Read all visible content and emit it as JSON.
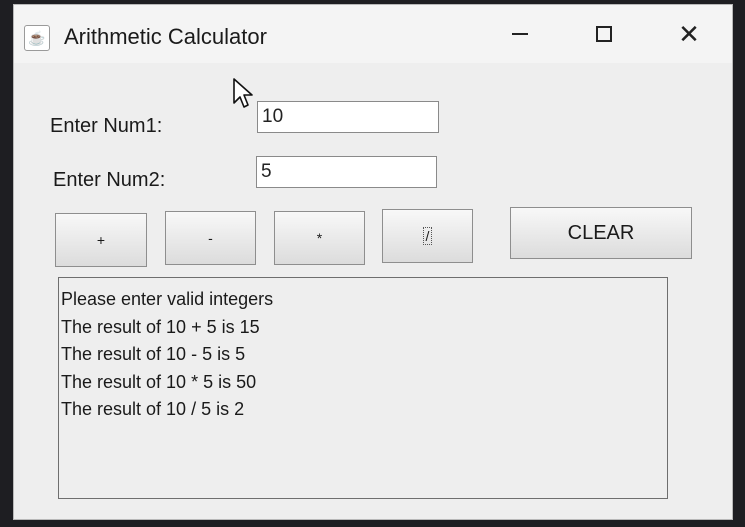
{
  "window": {
    "title": "Arithmetic Calculator",
    "icon": "java-cup-icon",
    "controls": {
      "minimize_icon": "minimize-icon",
      "maximize_icon": "maximize-icon",
      "close_label": "✕"
    }
  },
  "form": {
    "num1_label": "Enter Num1:",
    "num1_value": "10",
    "num2_label": "Enter Num2:",
    "num2_value": "5"
  },
  "buttons": {
    "add": "+",
    "subtract": "-",
    "multiply": "*",
    "divide": "/",
    "clear": "CLEAR"
  },
  "output": {
    "lines": [
      "Please enter valid integers",
      "The result of 10 + 5 is 15",
      "The result of 10 - 5 is 5",
      "The result of 10 * 5 is 50",
      "The result of 10 / 5 is 2"
    ]
  }
}
